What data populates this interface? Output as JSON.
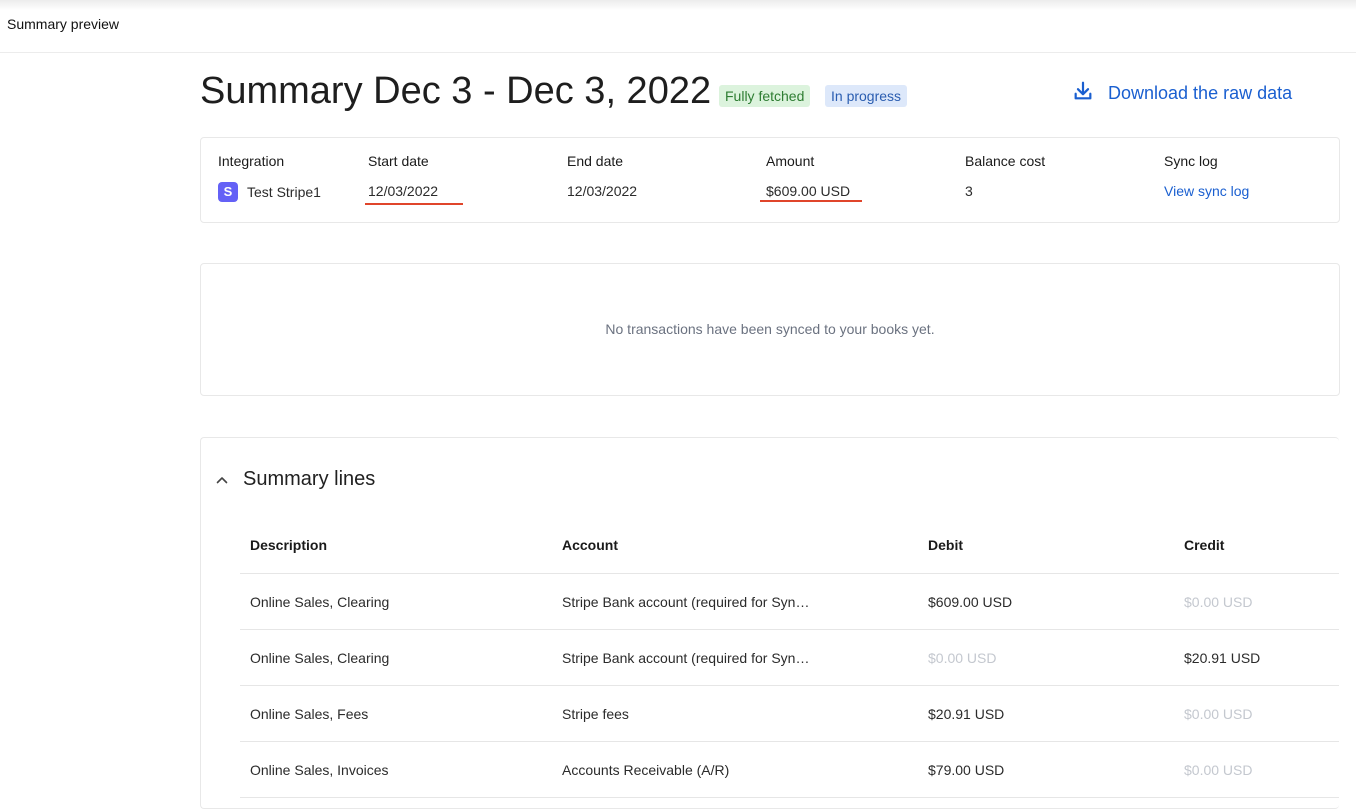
{
  "topbar": {
    "title": "Summary preview"
  },
  "header": {
    "title": "Summary Dec 3 - Dec 3, 2022",
    "badges": {
      "fetched": "Fully fetched",
      "progress": "In progress"
    },
    "download_label": "Download the raw data",
    "download_icon": "download-icon"
  },
  "info": {
    "integration": {
      "label": "Integration",
      "value": "Test Stripe1",
      "logo_letter": "S",
      "logo_color": "#6461f6"
    },
    "start_date": {
      "label": "Start date",
      "value": "12/03/2022"
    },
    "end_date": {
      "label": "End date",
      "value": "12/03/2022"
    },
    "amount": {
      "label": "Amount",
      "value": "$609.00 USD"
    },
    "balance_cost": {
      "label": "Balance cost",
      "value": "3"
    },
    "sync_log": {
      "label": "Sync log",
      "value": "View sync log"
    }
  },
  "empty_state": {
    "message": "No transactions have been synced to your books yet."
  },
  "summary": {
    "title": "Summary lines",
    "columns": {
      "description": "Description",
      "account": "Account",
      "debit": "Debit",
      "credit": "Credit"
    },
    "rows": [
      {
        "description": "Online Sales, Clearing",
        "account": "Stripe Bank account (required for Syn…",
        "debit": "$609.00 USD",
        "credit": "$0.00 USD"
      },
      {
        "description": "Online Sales, Clearing",
        "account": "Stripe Bank account (required for Syn…",
        "debit": "$0.00 USD",
        "credit": "$20.91 USD"
      },
      {
        "description": "Online Sales, Fees",
        "account": "Stripe fees",
        "debit": "$20.91 USD",
        "credit": "$0.00 USD"
      },
      {
        "description": "Online Sales, Invoices",
        "account": "Accounts Receivable (A/R)",
        "debit": "$79.00 USD",
        "credit": "$0.00 USD"
      }
    ]
  },
  "colors": {
    "link": "#1a5fd0",
    "annotation_underline": "#e0452b",
    "muted_zero": "#c4c8cf"
  }
}
